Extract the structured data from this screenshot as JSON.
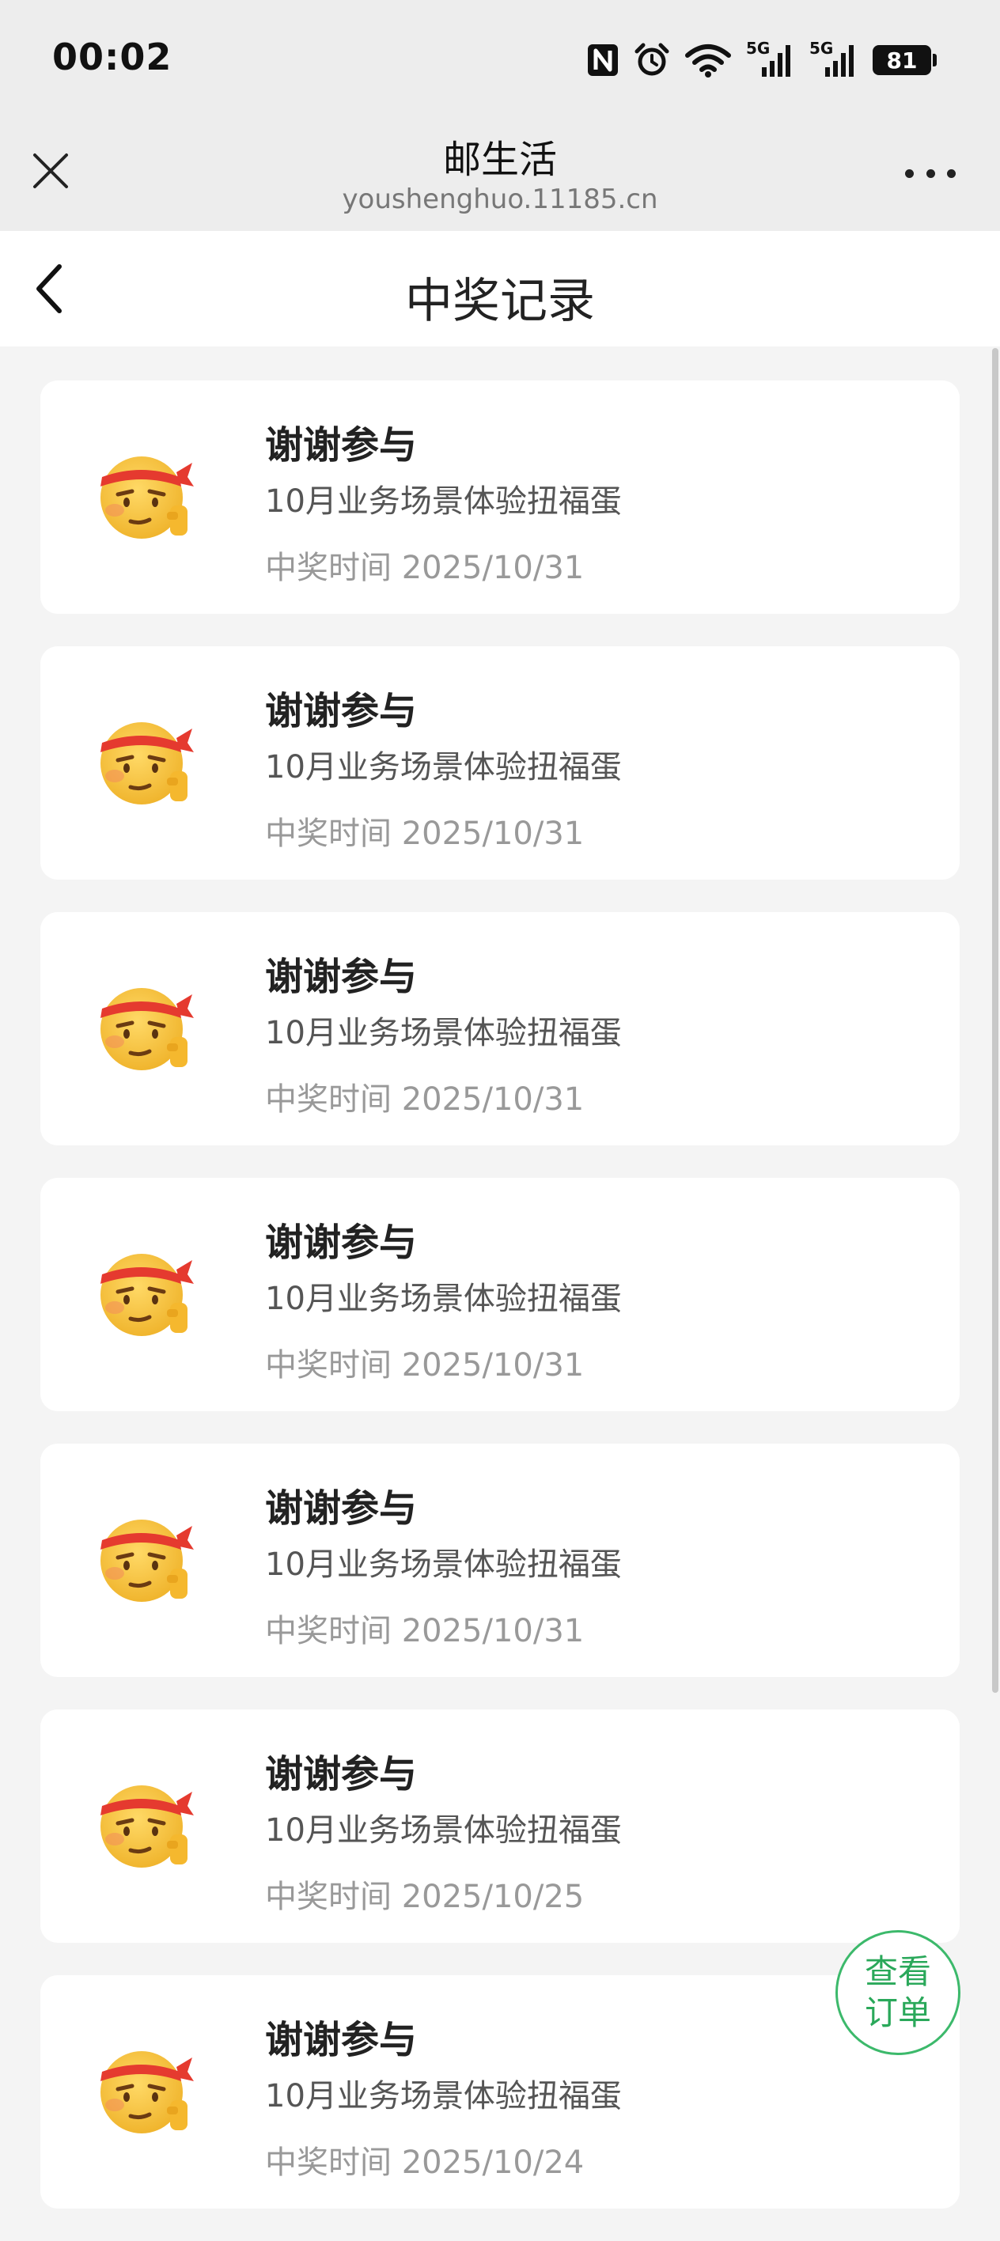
{
  "status_bar": {
    "time": "00:02",
    "signal_1_label": "5G",
    "signal_2_label": "5G",
    "battery": "81"
  },
  "mini_program": {
    "title": "邮生活",
    "url": "youshenghuo.11185.cn"
  },
  "page": {
    "title": "中奖记录"
  },
  "records": [
    {
      "name": "谢谢参与",
      "desc": "10月业务场景体验扭福蛋",
      "time": "中奖时间 2025/10/31"
    },
    {
      "name": "谢谢参与",
      "desc": "10月业务场景体验扭福蛋",
      "time": "中奖时间 2025/10/31"
    },
    {
      "name": "谢谢参与",
      "desc": "10月业务场景体验扭福蛋",
      "time": "中奖时间 2025/10/31"
    },
    {
      "name": "谢谢参与",
      "desc": "10月业务场景体验扭福蛋",
      "time": "中奖时间 2025/10/31"
    },
    {
      "name": "谢谢参与",
      "desc": "10月业务场景体验扭福蛋",
      "time": "中奖时间 2025/10/31"
    },
    {
      "name": "谢谢参与",
      "desc": "10月业务场景体验扭福蛋",
      "time": "中奖时间 2025/10/25"
    },
    {
      "name": "谢谢参与",
      "desc": "10月业务场景体验扭福蛋",
      "time": "中奖时间 2025/10/24"
    }
  ],
  "fab": {
    "line1": "查看",
    "line2": "订单"
  },
  "colors": {
    "accent_green": "#2aa85a",
    "headband_red": "#e53a2f",
    "emoji_yellow": "#f7c843"
  },
  "icons": {
    "record_icon": "fighting-emoji-icon",
    "close": "close-icon",
    "back": "chevron-left-icon",
    "more": "more-dots-icon"
  }
}
